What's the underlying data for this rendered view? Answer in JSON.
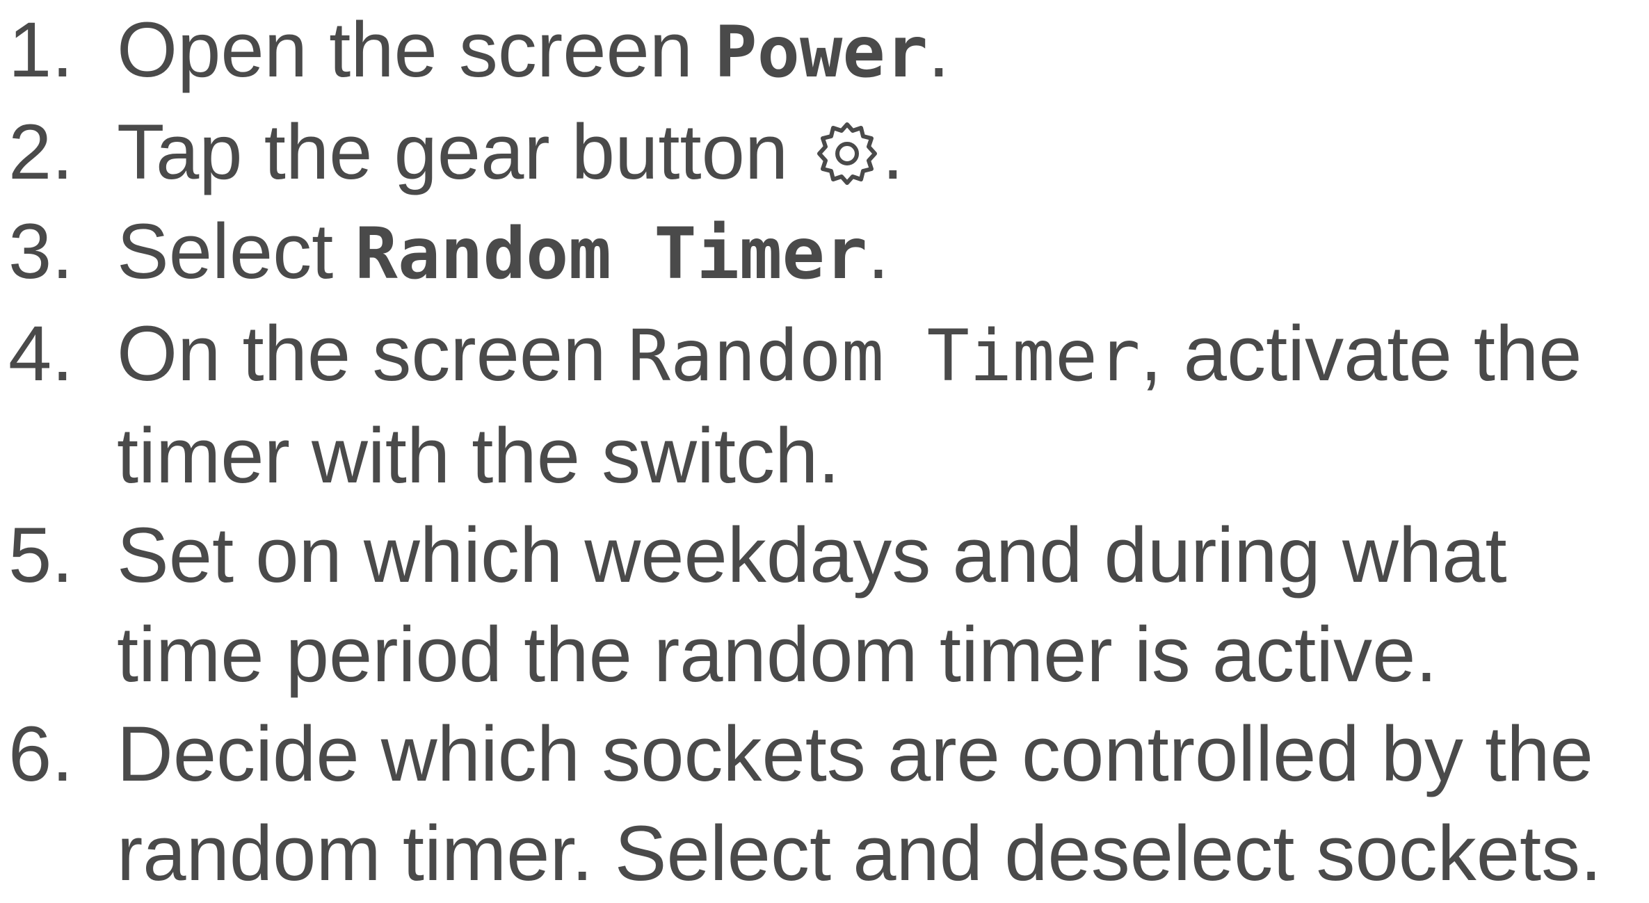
{
  "steps": [
    {
      "number": "1.",
      "before": "Open the screen ",
      "term": "Power",
      "after": "."
    },
    {
      "number": "2.",
      "before": "Tap the gear button ",
      "icon": "gear-icon",
      "after": "."
    },
    {
      "number": "3.",
      "before": "Select ",
      "term": "Random Timer",
      "after": "."
    },
    {
      "number": "4.",
      "before": "On the screen ",
      "term": "Random Timer",
      "after": ", activate the timer with the switch."
    },
    {
      "number": "5.",
      "text": "Set on which weekdays and during what time period the random timer is active."
    },
    {
      "number": "6.",
      "text": "Decide which sockets are controlled by the random timer. Select and deselect sockets."
    }
  ],
  "colors": {
    "text": "#4a4a4a",
    "background": "#ffffff"
  }
}
